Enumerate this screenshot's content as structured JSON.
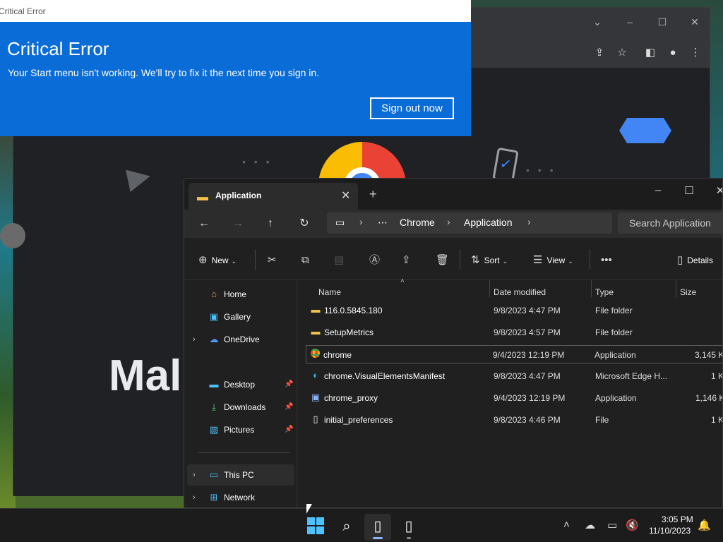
{
  "critical_error": {
    "window_title": "Critical Error",
    "heading": "Critical Error",
    "message": "Your Start menu isn't working. We'll try to fix it the next time you sign in.",
    "button": "Sign out now"
  },
  "chrome": {
    "welcome_text": "Mal"
  },
  "explorer": {
    "tab_title": "Application",
    "breadcrumb": [
      "Chrome",
      "Application"
    ],
    "search_placeholder": "Search Application",
    "commands": {
      "new": "New",
      "sort": "Sort",
      "view": "View",
      "details": "Details"
    },
    "sidebar": {
      "home": "Home",
      "gallery": "Gallery",
      "onedrive": "OneDrive",
      "desktop": "Desktop",
      "downloads": "Downloads",
      "pictures": "Pictures",
      "this_pc": "This PC",
      "network": "Network"
    },
    "columns": {
      "name": "Name",
      "date": "Date modified",
      "type": "Type",
      "size": "Size"
    },
    "files": [
      {
        "name": "116.0.5845.180",
        "date": "9/8/2023 4:47 PM",
        "type": "File folder",
        "size": "",
        "icon": "folder-icon"
      },
      {
        "name": "SetupMetrics",
        "date": "9/8/2023 4:57 PM",
        "type": "File folder",
        "size": "",
        "icon": "folder-icon"
      },
      {
        "name": "chrome",
        "date": "9/4/2023 12:19 PM",
        "type": "Application",
        "size": "3,145 K",
        "icon": "chrome-icon"
      },
      {
        "name": "chrome.VisualElementsManifest",
        "date": "9/8/2023 4:47 PM",
        "type": "Microsoft Edge H...",
        "size": "1 K",
        "icon": "edge-icon"
      },
      {
        "name": "chrome_proxy",
        "date": "9/4/2023 12:19 PM",
        "type": "Application",
        "size": "1,146 K",
        "icon": "app-icon"
      },
      {
        "name": "initial_preferences",
        "date": "9/8/2023 4:46 PM",
        "type": "File",
        "size": "1 K",
        "icon": "file-icon"
      }
    ]
  },
  "taskbar": {
    "time": "3:05 PM",
    "date": "11/10/2023"
  },
  "colors": {
    "dialog_blue": "#0a6cd6",
    "accent": "#4cc2ff",
    "folder": "#f2c14e"
  }
}
